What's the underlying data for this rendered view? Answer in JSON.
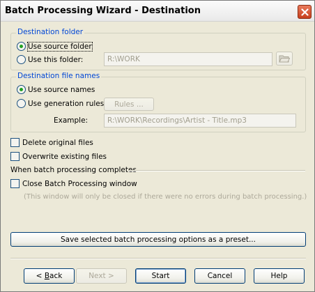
{
  "window": {
    "title": "Batch Processing Wizard - Destination",
    "close_icon": "close-x-icon"
  },
  "destination_folder": {
    "legend": "Destination folder",
    "use_source_folder": "Use source folder",
    "use_this_folder": "Use this folder:",
    "folder_path": "R:\\WORK",
    "browse_icon": "folder-open-icon",
    "selected": "use_source_folder"
  },
  "destination_file_names": {
    "legend": "Destination file names",
    "use_source_names": "Use source names",
    "use_generation_rules": "Use generation rules",
    "rules_button": "Rules ...",
    "example_label": "Example:",
    "example_value": "R:\\WORK\\Recordings\\Artist - Title.mp3",
    "selected": "use_source_names"
  },
  "options": {
    "delete_original": "Delete original files",
    "delete_original_checked": false,
    "overwrite_existing": "Overwrite existing files",
    "overwrite_existing_checked": false
  },
  "completion": {
    "heading": "When batch processing completes",
    "close_window": "Close Batch Processing window",
    "close_window_checked": false,
    "note": "(This window will only be closed if there were no errors during batch processing.)"
  },
  "save_preset_button": "Save selected batch processing options as a preset...",
  "footer": {
    "back_prefix": "< ",
    "back_hotkey": "B",
    "back_suffix": "ack",
    "next": "Next >",
    "start": "Start",
    "cancel": "Cancel",
    "help": "Help"
  },
  "colors": {
    "legend_blue": "#0046d5",
    "radio_selected": "#21a121",
    "close_red": "#c8401d"
  }
}
